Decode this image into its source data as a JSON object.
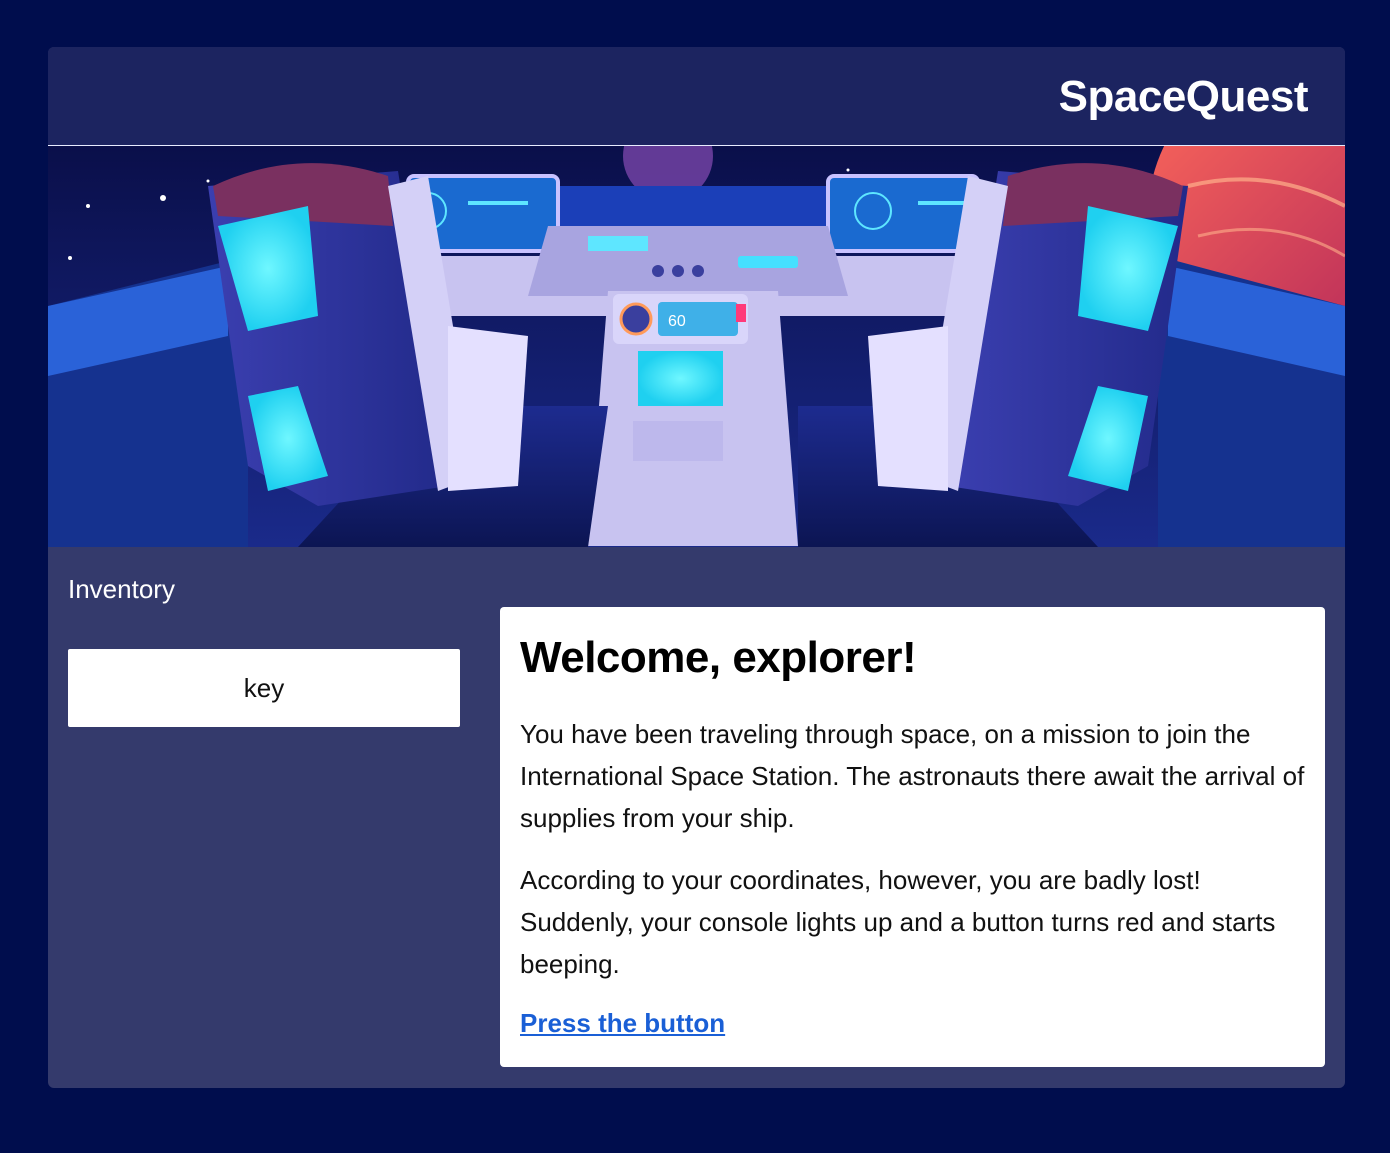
{
  "header": {
    "brand": "SpaceQuest"
  },
  "banner": {
    "image": "spaceship-cockpit-illustration",
    "gauge_readout": "60"
  },
  "inventory": {
    "title": "Inventory",
    "items": [
      {
        "label": "key"
      }
    ]
  },
  "story": {
    "title": "Welcome, explorer!",
    "paragraphs": [
      "You have been traveling through space, on a mission to join the International Space Station. The astronauts there await the arrival of supplies from your ship.",
      "According to your coordinates, however, you are badly lost! Suddenly, your console lights up and a button turns red and starts beeping."
    ],
    "action_link": "Press the button"
  },
  "colors": {
    "page_bg": "#000d4d",
    "panel_bg": "#343a6c",
    "header_bg": "#1c2460",
    "link": "#1a5fd6"
  }
}
